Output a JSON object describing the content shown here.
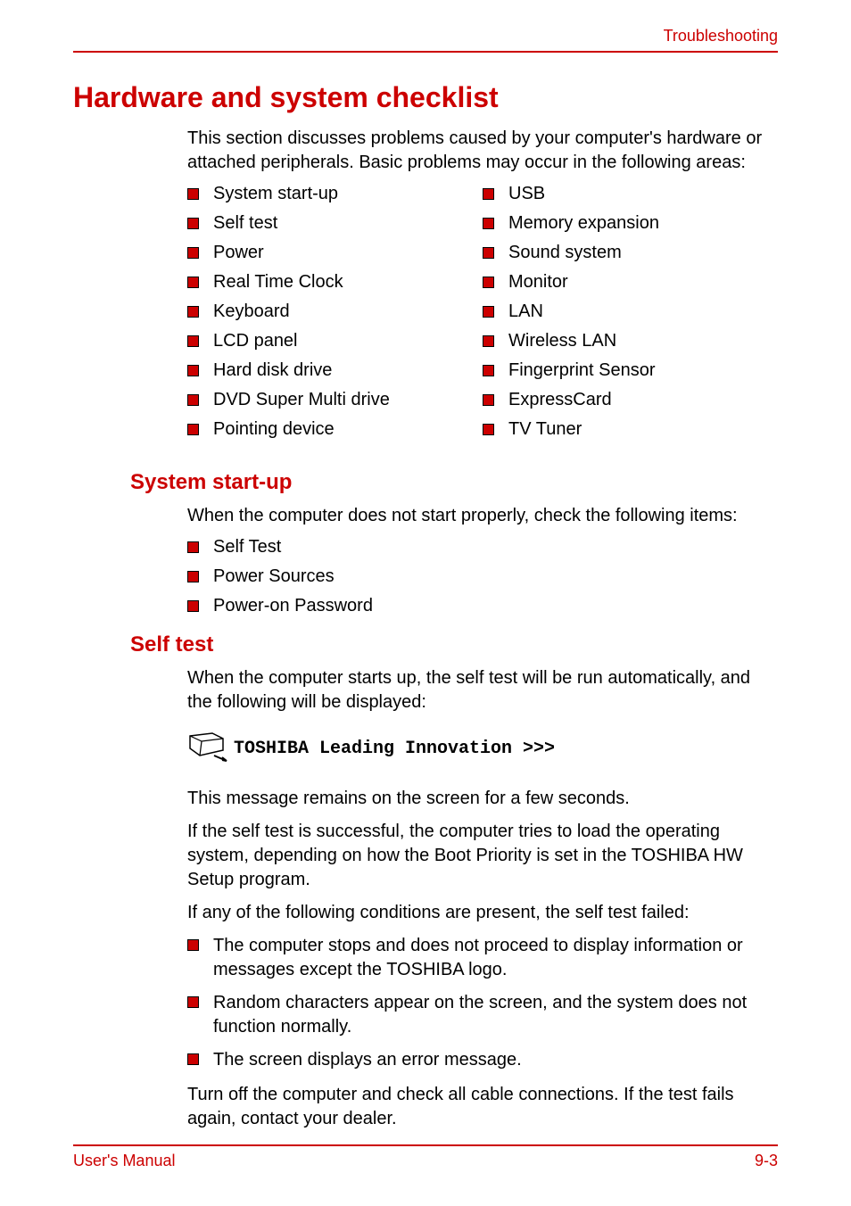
{
  "header": {
    "label": "Troubleshooting"
  },
  "main": {
    "title": "Hardware and system checklist",
    "intro": "This section discusses problems caused by your computer's hardware or attached peripherals. Basic problems may occur in the following areas:",
    "checklist_left": [
      "System start-up",
      "Self test",
      "Power",
      "Real Time Clock",
      "Keyboard",
      "LCD panel",
      "Hard disk drive",
      "DVD Super Multi drive",
      "Pointing device"
    ],
    "checklist_right": [
      "USB",
      "Memory expansion",
      "Sound system",
      "Monitor",
      "LAN",
      "Wireless LAN",
      "Fingerprint Sensor",
      "ExpressCard",
      "TV Tuner"
    ]
  },
  "section1": {
    "heading": "System start-up",
    "intro": "When the computer does not start properly, check the following items:",
    "items": [
      "Self Test",
      "Power Sources",
      "Power-on Password"
    ]
  },
  "section2": {
    "heading": "Self test",
    "intro": "When the computer starts up, the self test will be run automatically, and the following will be displayed:",
    "note": "TOSHIBA Leading Innovation >>>",
    "para1": "This message remains on the screen for a few seconds.",
    "para2": "If the self test is successful, the computer tries to load the operating system, depending on how the Boot Priority is set in the TOSHIBA HW Setup program.",
    "para3": "If any of the following conditions are present, the self test failed:",
    "fail_items": [
      "The computer stops and does not proceed to display information or messages except the TOSHIBA logo.",
      "Random characters appear on the screen, and the system does not function normally.",
      "The screen displays an error message."
    ],
    "para4": "Turn off the computer and check all cable connections. If the test fails again, contact your dealer."
  },
  "footer": {
    "left": "User's Manual",
    "right": "9-3"
  }
}
